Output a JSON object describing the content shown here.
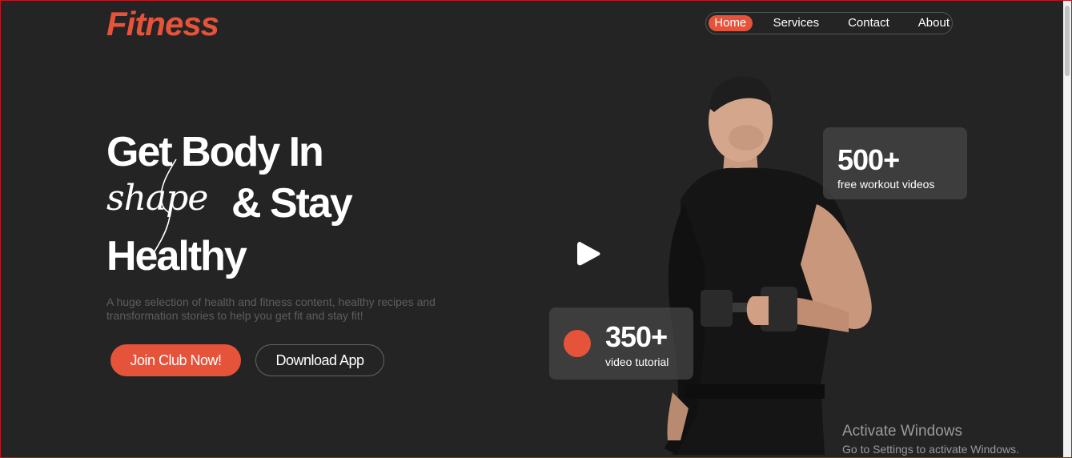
{
  "brand": {
    "logo": "Fitness",
    "accent": "#e5533b",
    "background": "#242424"
  },
  "nav": {
    "items": [
      {
        "label": "Home",
        "active": true
      },
      {
        "label": "Services",
        "active": false
      },
      {
        "label": "Contact",
        "active": false
      },
      {
        "label": "About",
        "active": false
      }
    ]
  },
  "hero": {
    "line1": "Get Body In",
    "script_word": "shape",
    "line2": "& Stay",
    "line3": "Healthy",
    "description": "A huge selection of health and fitness content, healthy recipes and transformation stories to help you get fit and stay fit!",
    "join_button": "Join Club Now!",
    "download_button": "Download App"
  },
  "stats": {
    "videos": {
      "value": "500+",
      "label": "free workout videos"
    },
    "tutorials": {
      "value": "350+",
      "label": "video tutorial"
    }
  },
  "icons": {
    "play": "play-icon",
    "record": "record-dot-icon"
  },
  "watermark": {
    "title": "Activate Windows",
    "subtitle": "Go to Settings to activate Windows."
  }
}
